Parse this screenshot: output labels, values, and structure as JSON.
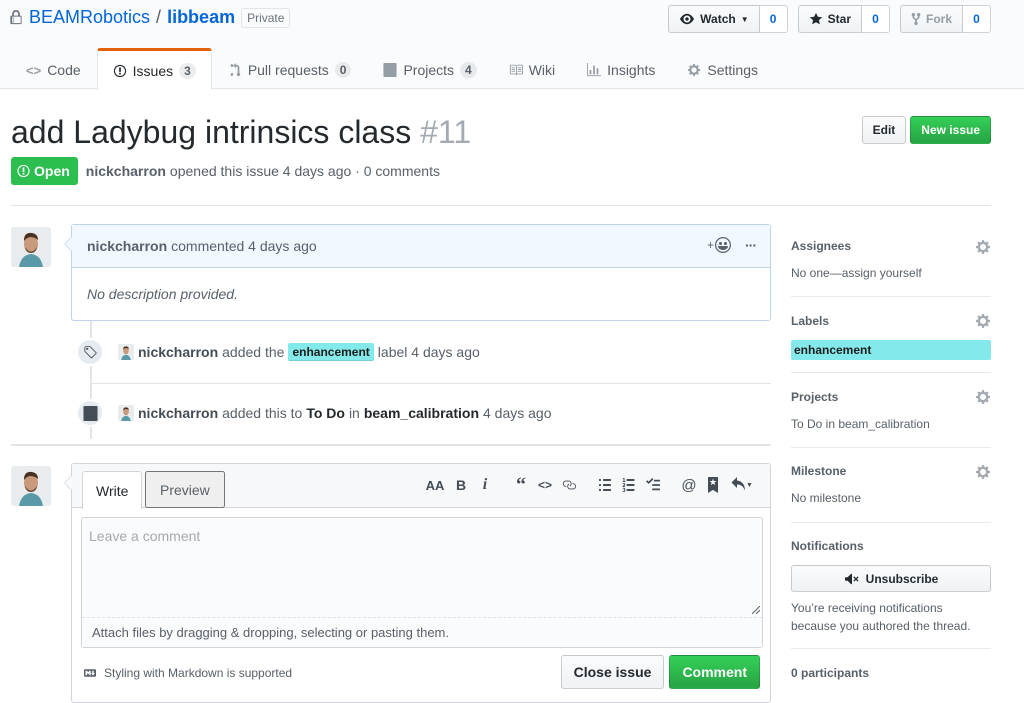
{
  "repo": {
    "owner": "BEAMRobotics",
    "separator": "/",
    "name": "libbeam",
    "visibility": "Private"
  },
  "actions": {
    "watch_label": "Watch",
    "watch_count": "0",
    "star_label": "Star",
    "star_count": "0",
    "fork_label": "Fork",
    "fork_count": "0"
  },
  "nav": {
    "code": "Code",
    "issues": "Issues",
    "issues_count": "3",
    "pulls": "Pull requests",
    "pulls_count": "0",
    "projects": "Projects",
    "projects_count": "4",
    "wiki": "Wiki",
    "insights": "Insights",
    "settings": "Settings"
  },
  "issue": {
    "title": "add Ladybug intrinsics class",
    "number": "#11",
    "edit_label": "Edit",
    "new_issue_label": "New issue",
    "state": "Open",
    "author": "nickcharron",
    "meta": "opened this issue 4 days ago · 0 comments"
  },
  "comment": {
    "author": "nickcharron",
    "meta": "commented 4 days ago",
    "reaction_glyph": "+",
    "more_glyph": "···",
    "body": "No description provided."
  },
  "events": {
    "label_event": {
      "author": "nickcharron",
      "pre": "added the",
      "label": "enhancement",
      "post": "label 4 days ago"
    },
    "project_event": {
      "author": "nickcharron",
      "pre": "added this to",
      "column": "To Do",
      "mid": "in",
      "project": "beam_calibration",
      "post": "4 days ago"
    }
  },
  "new_comment": {
    "write_tab": "Write",
    "preview_tab": "Preview",
    "placeholder": "Leave a comment",
    "attach_hint": "Attach files by dragging & dropping, selecting or pasting them.",
    "markdown_note": "Styling with Markdown is supported",
    "close_label": "Close issue",
    "comment_label": "Comment",
    "toolbar": {
      "header": "AA",
      "bold": "B",
      "italic": "i",
      "mention": "@"
    }
  },
  "sidebar": {
    "assignees_heading": "Assignees",
    "assignees_value": "No one—assign yourself",
    "labels_heading": "Labels",
    "label_value": "enhancement",
    "projects_heading": "Projects",
    "projects_value": "To Do in beam_calibration",
    "milestone_heading": "Milestone",
    "milestone_value": "No milestone",
    "notifications_heading": "Notifications",
    "unsubscribe_label": "Unsubscribe",
    "notifications_reason": "You’re receiving notifications because you authored the thread.",
    "participants": "0 participants"
  },
  "colors": {
    "link": "#0366d6",
    "open_state": "#2cbe4e",
    "primary_button": "#28a745",
    "label_enhancement": "#84e9ea",
    "selected_tab_accent": "#e36209"
  }
}
